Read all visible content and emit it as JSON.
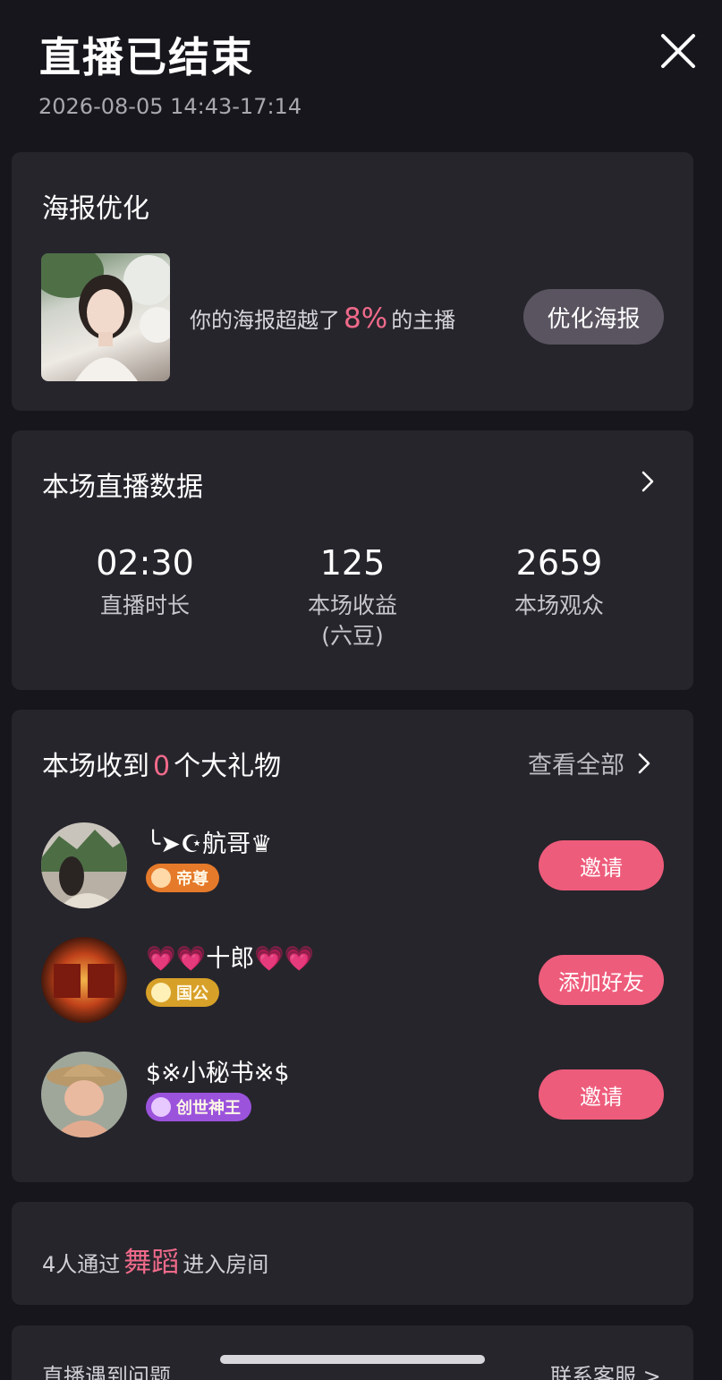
{
  "header": {
    "title": "直播已结束",
    "time_range": "2026-08-05 14:43-17:14",
    "close_icon": "close-icon"
  },
  "poster": {
    "title": "海报优化",
    "desc_prefix": "你的海报超越了",
    "percent": "8%",
    "desc_suffix": "的主播",
    "button": "优化海报"
  },
  "stats": {
    "title": "本场直播数据",
    "items": [
      {
        "value": "02:30",
        "label": "直播时长",
        "unit": ""
      },
      {
        "value": "125",
        "label": "本场收益",
        "unit": "(六豆)"
      },
      {
        "value": "2659",
        "label": "本场观众",
        "unit": ""
      }
    ]
  },
  "gifts": {
    "title_prefix": "本场收到",
    "count": "0",
    "title_suffix": "个大礼物",
    "view_all": "查看全部",
    "users": [
      {
        "name": "╰➤☪航哥♛",
        "badge": "帝尊",
        "badge_color": "#e57a2a",
        "button": "邀请"
      },
      {
        "name": "💗💗十郎💗💗",
        "badge": "国公",
        "badge_color": "#d7a028",
        "button": "添加好友"
      },
      {
        "name": "$※小秘书※$",
        "badge": "创世神王",
        "badge_color": "#9b53dc",
        "button": "邀请"
      }
    ]
  },
  "entry": {
    "prefix": "4人通过",
    "source": "舞蹈",
    "suffix": "进入房间"
  },
  "help": {
    "text": "直播遇到问题",
    "link": "联系客服 >"
  },
  "colors": {
    "background": "#17161c",
    "card": "#26252c",
    "accent": "#ee5c7b",
    "highlight": "#f06a8a"
  }
}
